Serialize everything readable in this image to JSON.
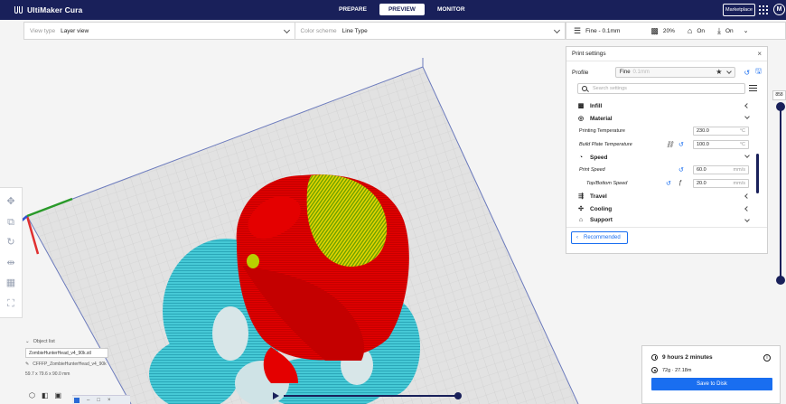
{
  "app": {
    "name": "UltiMaker Cura",
    "stages": [
      {
        "label": "PREPARE",
        "active": false
      },
      {
        "label": "PREVIEW",
        "active": true
      },
      {
        "label": "MONITOR",
        "active": false
      }
    ],
    "marketplace_label": "Marketplace",
    "avatar_initial": "M"
  },
  "view_bar": {
    "view_type_label": "View type",
    "view_type_value": "Layer view",
    "color_scheme_label": "Color scheme",
    "color_scheme_value": "Line Type"
  },
  "print_setup_bar": {
    "profile": "Fine - 0.1mm",
    "infill": "20%",
    "support": "On",
    "adhesion": "On"
  },
  "print_settings": {
    "title": "Print settings",
    "close_glyph": "×",
    "profile_label": "Profile",
    "profile_value": "Fine",
    "profile_suffix": "0.1mm",
    "search_placeholder": "Search settings",
    "categories": [
      {
        "label": "Infill",
        "icon": "infill-icon",
        "expanded": false
      },
      {
        "label": "Material",
        "icon": "material-icon",
        "expanded": true
      },
      {
        "label": "Speed",
        "icon": "speed-icon",
        "expanded": true
      },
      {
        "label": "Travel",
        "icon": "travel-icon",
        "expanded": false
      },
      {
        "label": "Cooling",
        "icon": "cooling-icon",
        "expanded": false
      },
      {
        "label": "Support",
        "icon": "support-icon",
        "expanded": true
      }
    ],
    "material_settings": [
      {
        "label": "Printing Temperature",
        "value": "230.0",
        "unit": "°C"
      },
      {
        "label": "Build Plate Temperature",
        "value": "100.0",
        "unit": "°C"
      }
    ],
    "speed_settings": [
      {
        "label": "Print Speed",
        "value": "60.0",
        "unit": "mm/s"
      },
      {
        "label": "Top/Bottom Speed",
        "value": "20.0",
        "unit": "mm/s"
      }
    ],
    "recommended_label": "Recommended"
  },
  "layer_view": {
    "current_layer": "858"
  },
  "object_list": {
    "header": "Object list",
    "object_name": "ZombieHunterHead_v4_90k.stl",
    "job_name": "CFFFP_ZombieHunterHead_v4_90k",
    "dimensions": "59.7 x 79.6 x 90.0 mm"
  },
  "print_summary": {
    "print_time": "9 hours 2 minutes",
    "material_usage": "72g · 27.18m",
    "save_label": "Save to Disk"
  },
  "colors": {
    "header_bg": "#19205a",
    "accent": "#196ef0",
    "wall_outer": "#e00000",
    "infill": "#a8d400",
    "support": "#44c8d8",
    "skin": "#f2e23a",
    "axis_x": "#e03030",
    "axis_y": "#2a9a2a",
    "axis_z": "#3050d0"
  }
}
